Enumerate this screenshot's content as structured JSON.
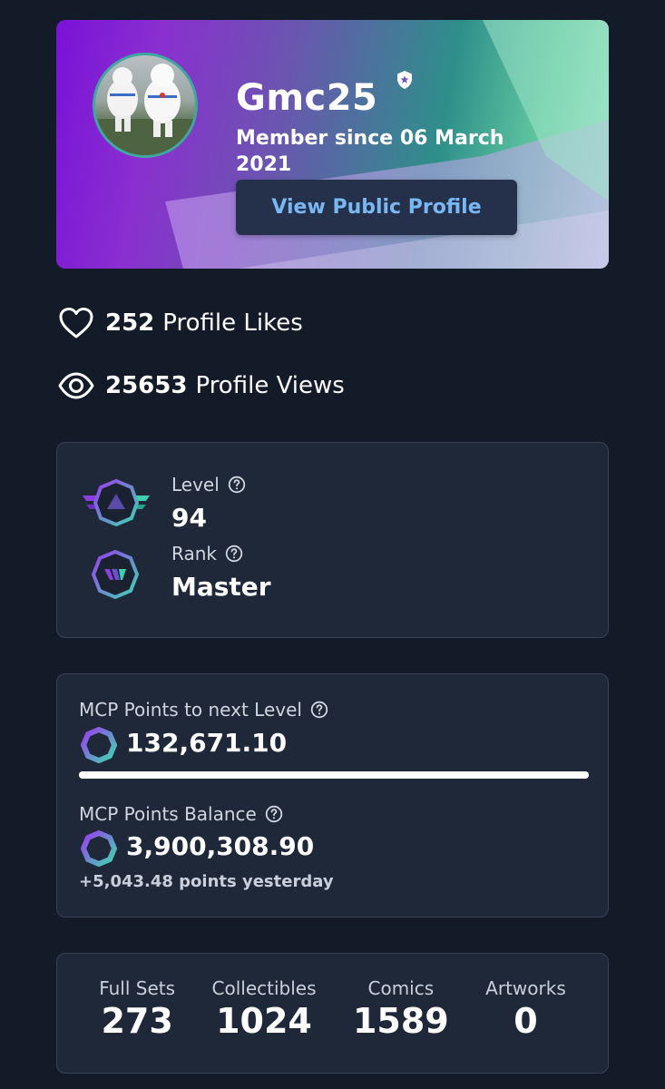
{
  "profile": {
    "username": "Gmc25",
    "member_since": "Member since 06 March 2021",
    "public_profile_button": "View Public Profile",
    "avatar_icon": "avatar-image",
    "verified_icon": "verified-shield-icon"
  },
  "stats": {
    "likes_count": "252",
    "likes_label": "Profile Likes",
    "views_count": "25653",
    "views_label": "Profile Views"
  },
  "level_card": {
    "level_label": "Level",
    "level_value": "94",
    "rank_label": "Rank",
    "rank_value": "Master"
  },
  "points_card": {
    "next_level_label": "MCP Points to next Level",
    "next_level_value": "132,671.10",
    "progress_fraction": 1.0,
    "balance_label": "MCP Points Balance",
    "balance_value": "3,900,308.90",
    "yesterday_text": "+5,043.48 points yesterday"
  },
  "counts": [
    {
      "label": "Full Sets",
      "value": "273"
    },
    {
      "label": "Collectibles",
      "value": "1024"
    },
    {
      "label": "Comics",
      "value": "1589"
    },
    {
      "label": "Artworks",
      "value": "0"
    }
  ],
  "colors": {
    "background": "#131a28",
    "card": "#1f2838",
    "button_text": "#79b7f3",
    "accent_purple": "#8b3fe0",
    "accent_teal": "#3fcfb0"
  }
}
